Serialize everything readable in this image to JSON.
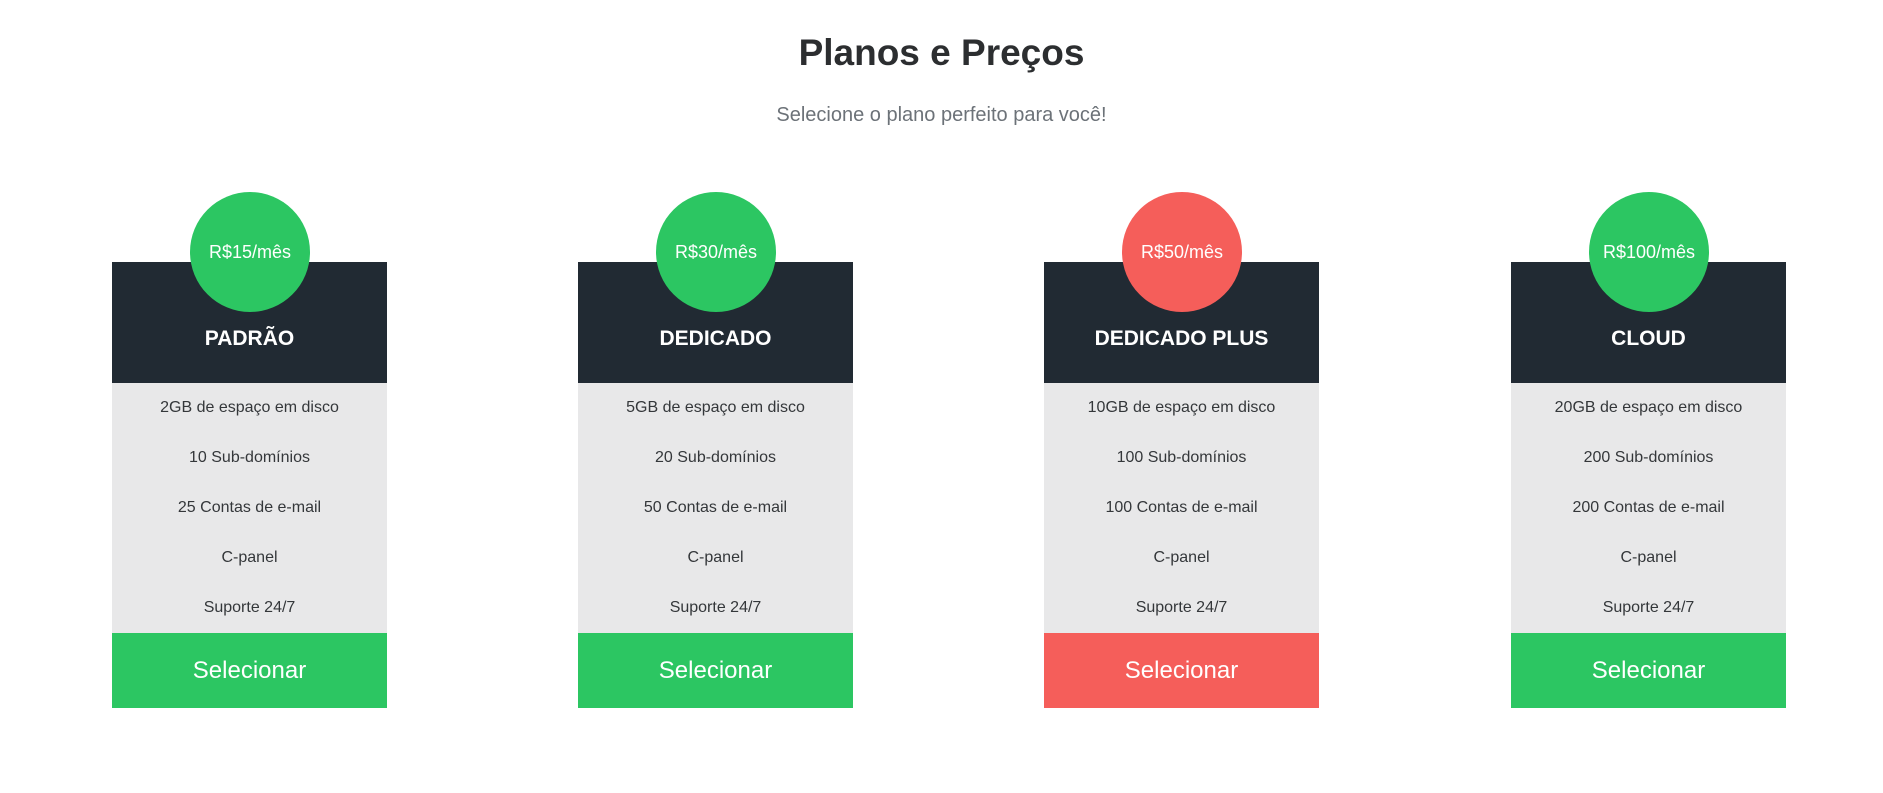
{
  "header": {
    "title": "Planos e Preços",
    "subtitle": "Selecione o plano perfeito para você!"
  },
  "colors": {
    "accent_green": "#2cc662",
    "accent_red": "#f55e5a",
    "header_dark": "#212a33",
    "feature_bg": "#e8e8e9"
  },
  "plans": [
    {
      "price": "R$15/mês",
      "name": "PADRÃO",
      "features": [
        "2GB de espaço em disco",
        "10 Sub-domínios",
        "25 Contas de e-mail",
        "C-panel",
        "Suporte 24/7"
      ],
      "button": "Selecionar"
    },
    {
      "price": "R$30/mês",
      "name": "DEDICADO",
      "features": [
        "5GB de espaço em disco",
        "20 Sub-domínios",
        "50 Contas de e-mail",
        "C-panel",
        "Suporte 24/7"
      ],
      "button": "Selecionar"
    },
    {
      "price": "R$50/mês",
      "name": "DEDICADO PLUS",
      "features": [
        "10GB de espaço em disco",
        "100 Sub-domínios",
        "100 Contas de e-mail",
        "C-panel",
        "Suporte 24/7"
      ],
      "button": "Selecionar"
    },
    {
      "price": "R$100/mês",
      "name": "CLOUD",
      "features": [
        "20GB de espaço em disco",
        "200 Sub-domínios",
        "200 Contas de e-mail",
        "C-panel",
        "Suporte 24/7"
      ],
      "button": "Selecionar"
    }
  ]
}
